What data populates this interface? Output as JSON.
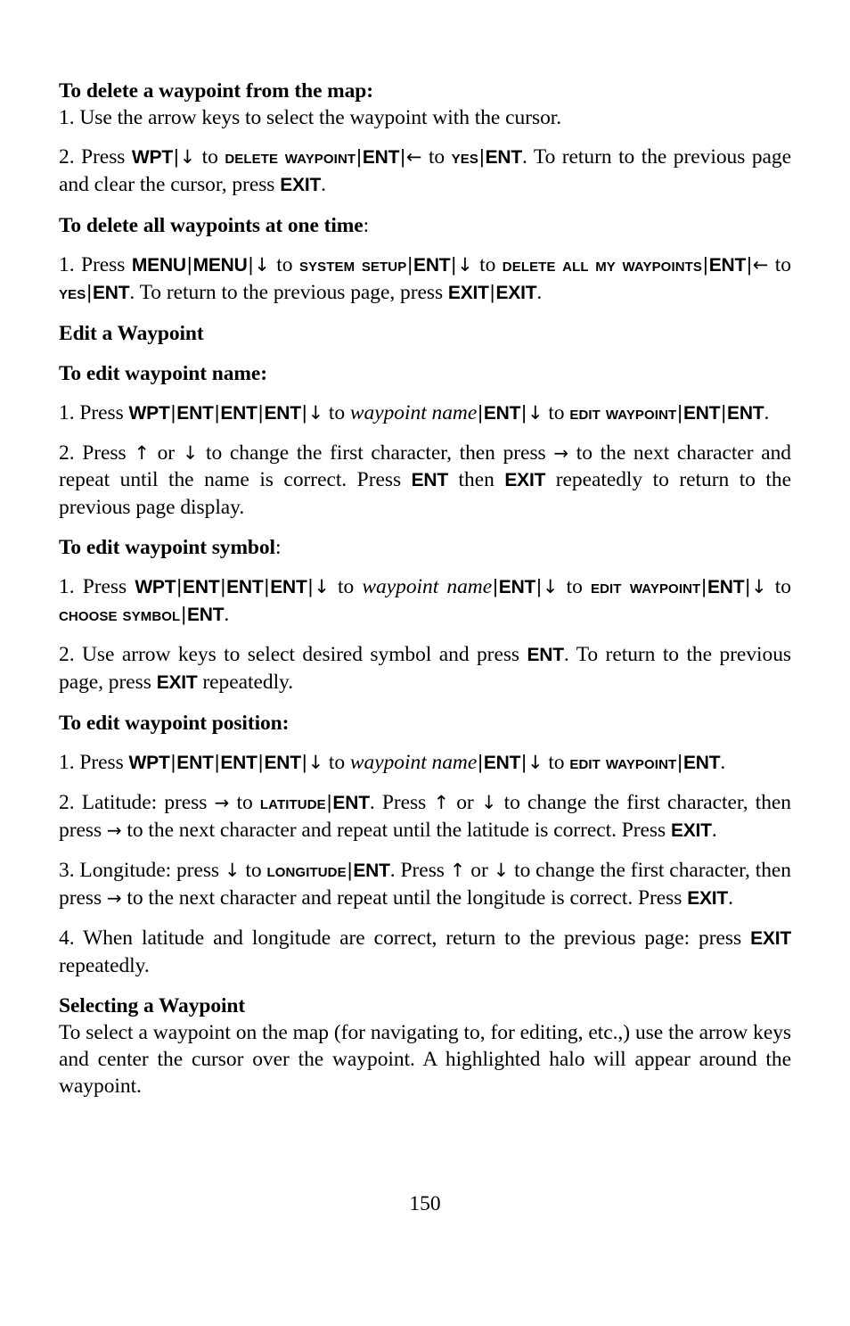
{
  "document": {
    "page_number": "150"
  },
  "sections": {
    "delete_from_map": {
      "heading": "To delete a waypoint from the map:",
      "step1": "1. Use the arrow keys to select the waypoint with the cursor.",
      "step2": {
        "lead": "2. Press ",
        "key_wpt": "WPT",
        "to_1": " to ",
        "menu_delete_waypoint": "Delete Waypoint",
        "key_ent_1": "ENT",
        "to_2": " to ",
        "menu_yes": "Yes",
        "key_ent_2": "ENT",
        "tail": ". To return to the previous page and clear the cursor, press ",
        "key_exit": "EXIT",
        "period": "."
      }
    },
    "delete_all": {
      "heading_bold": "To delete all waypoints at one time",
      "heading_colon": ":",
      "step1": {
        "lead": "1. Press ",
        "key_menu_1": "MENU",
        "key_menu_2": "MENU",
        "to_1": " to ",
        "menu_system_setup": "System Setup",
        "key_ent_1": "ENT",
        "to_2": " to ",
        "menu_delete_all": "Delete All My Waypoints",
        "key_ent_2": "ENT",
        "to_3": " to ",
        "menu_yes": "Yes",
        "key_ent_3": "ENT",
        "tail": ". To return to the previous page, press ",
        "key_exit_1": "EXIT",
        "key_exit_2": "EXIT",
        "period": "."
      }
    },
    "edit_waypoint": {
      "heading": "Edit a Waypoint"
    },
    "edit_name": {
      "heading": "To edit waypoint name:",
      "step1": {
        "lead": "1. Press ",
        "key_wpt": "WPT",
        "key_ent_1": "ENT",
        "key_ent_2": "ENT",
        "key_ent_3": "ENT",
        "to_1": " to ",
        "var_waypoint_name": "waypoint name",
        "key_ent_4": "ENT",
        "to_2": " to ",
        "menu_edit_waypoint": "Edit Waypoint",
        "key_ent_5": "ENT",
        "key_ent_6": "ENT",
        "period": "."
      },
      "step2": {
        "lead": "2. Press ",
        "or": " or ",
        "mid_1": " to change the first character, then press ",
        "mid_2": " to the next character and repeat until the name is correct. Press ",
        "key_ent": "ENT",
        "then": " then ",
        "key_exit": "EXIT",
        "tail": " repeatedly to return to the previous page display."
      }
    },
    "edit_symbol": {
      "heading_bold": "To edit waypoint symbol",
      "heading_colon": ":",
      "step1": {
        "lead": "1. Press ",
        "key_wpt": "WPT",
        "key_ent_1": "ENT",
        "key_ent_2": "ENT",
        "key_ent_3": "ENT",
        "to_1": " to ",
        "var_waypoint_name": "waypoint name",
        "key_ent_4": "ENT",
        "to_2": " to ",
        "menu_edit_waypoint": "Edit Waypoint",
        "key_ent_5": "ENT",
        "to_3": " to ",
        "menu_choose_symbol": "Choose Symbol",
        "key_ent_6": "ENT",
        "period": "."
      },
      "step2": {
        "lead": "2. Use arrow keys to select desired symbol and press ",
        "key_ent": "ENT",
        "mid": ". To return to the previous page, press ",
        "key_exit": "EXIT",
        "tail": " repeatedly."
      }
    },
    "edit_position": {
      "heading": "To edit waypoint position:",
      "step1": {
        "lead": "1. Press ",
        "key_wpt": "WPT",
        "key_ent_1": "ENT",
        "key_ent_2": "ENT",
        "key_ent_3": "ENT",
        "to_1": " to ",
        "var_waypoint_name": "waypoint name",
        "key_ent_4": "ENT",
        "to_2": " to ",
        "menu_edit_waypoint": "Edit Waypoint",
        "key_ent_5": "ENT",
        "period": "."
      },
      "step2": {
        "lead": "2. Latitude: press ",
        "to_1": " to ",
        "menu_latitude": "Latitude",
        "key_ent": "ENT",
        "press": ". Press ",
        "or": " or ",
        "mid_1": " to change the first character, then press ",
        "mid_2": " to the next character and repeat until the latitude is correct. Press ",
        "key_exit": "EXIT",
        "period": "."
      },
      "step3": {
        "lead": "3. Longitude: press ",
        "to_1": " to ",
        "menu_longitude": "Longitude",
        "key_ent": "ENT",
        "press": ". Press ",
        "or": " or ",
        "mid_1": " to change the first character, then press ",
        "mid_2": " to the next character and repeat until the longitude is correct. Press ",
        "key_exit": "EXIT",
        "period": "."
      },
      "step4": {
        "lead": "4. When latitude and longitude are correct, return to the previous page: press ",
        "key_exit": "EXIT",
        "tail": " repeatedly."
      }
    },
    "selecting": {
      "heading": "Selecting a Waypoint",
      "body": "To select a waypoint on the map (for navigating to, for editing, etc.,) use the arrow keys and center the cursor over the waypoint. A highlighted halo will appear around the waypoint."
    }
  },
  "glyphs": {
    "arrow_down": "↓",
    "arrow_up": "↑",
    "arrow_left": "←",
    "arrow_right": "→",
    "separator": "|"
  }
}
